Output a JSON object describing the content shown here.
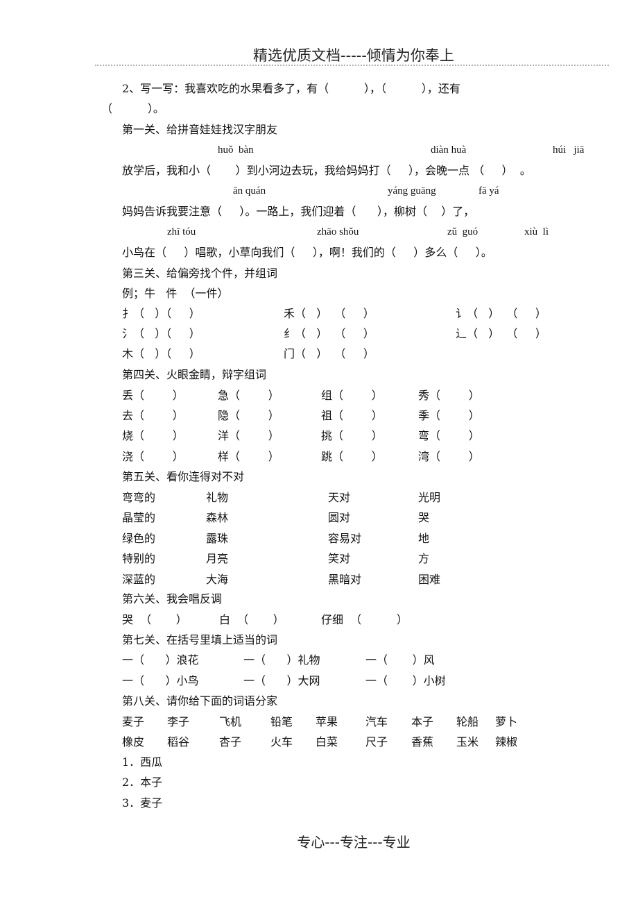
{
  "header": {
    "title": "精选优质文档-----倾情为你奉上"
  },
  "footer": {
    "text": "专心---专注---专业"
  },
  "section2": {
    "line1": "2、写一写：我喜欢吃的水果看多了，有（          ），（          ），还有",
    "line2": "（          ）。"
  },
  "section_1": {
    "title": "第一关、给拼音娃娃找汉字朋友",
    "pinyin_rows": [
      [
        "huǒ  bàn",
        "diàn huà",
        "húi   jiā"
      ],
      [
        "ān quán",
        "yáng guāng",
        "fā yá"
      ],
      [
        "zhī tóu",
        "zhāo shǒu",
        "zǔ  guó",
        "xiù  lì"
      ]
    ],
    "sentences": [
      "放学后，我和小（       ）到小河边去玩，我给妈妈打（     ），会晚一点 （     ）  。",
      "妈妈告诉我要注意（     ）。一路上，我们迎着（      ），柳树（    ）了，",
      "小鸟在（     ）唱歌，小草向我们（     ），啊！我们的（     ）多么（     ）。"
    ]
  },
  "section_3": {
    "title": "第三关、给偏旁找个件，并组词",
    "example": "例；牛   件  （一件）",
    "rows": [
      [
        "扌（   ）（     ）",
        "禾（   ）  （     ）",
        "讠（   ）  （     ）"
      ],
      [
        "氵（   ）（     ）",
        "纟（   ）  （     ）",
        "辶（   ）  （     ）"
      ],
      [
        "木（   ）（     ）",
        "门（   ）  （     ）",
        ""
      ]
    ]
  },
  "section_4": {
    "title": "第四关、火眼金睛，辩字组词",
    "rows": [
      [
        "丢（        ）",
        "急（        ）",
        "组（        ）",
        "秀（        ）"
      ],
      [
        "去（        ）",
        "隐（        ）",
        "祖（        ）",
        "季（        ）"
      ],
      [
        "烧（        ）",
        "洋（        ）",
        "挑（        ）",
        "弯（        ）"
      ],
      [
        "浇（        ）",
        "样（        ）",
        "跳（        ）",
        "湾（        ）"
      ]
    ]
  },
  "section_5": {
    "title": "第五关、看你连得对不对",
    "rows": [
      [
        "弯弯的",
        "礼物",
        "天对",
        "光明"
      ],
      [
        "晶莹的",
        "森林",
        "圆对",
        "哭"
      ],
      [
        "绿色的",
        "露珠",
        "容易对",
        "地"
      ],
      [
        "特别的",
        "月亮",
        "笑对",
        "方"
      ],
      [
        "深蓝的",
        "大海",
        "黑暗对",
        "困难"
      ]
    ]
  },
  "section_6": {
    "title": "第六关、我会唱反调",
    "items": [
      "哭  （       ）",
      "白  （       ）",
      "仔细  （          ）"
    ]
  },
  "section_7": {
    "title": "第七关、在括号里填上适当的词",
    "rows": [
      [
        "一（      ）浪花",
        "一（      ）礼物",
        "一（       ）风"
      ],
      [
        "一（      ）小鸟",
        "一（      ）大网",
        "一（       ）小树"
      ]
    ]
  },
  "section_8": {
    "title": "第八关、请你给下面的词语分家",
    "words_rows": [
      [
        "麦子",
        "李子",
        "飞机",
        "铅笔",
        "苹果",
        "汽车",
        "本子",
        "轮船",
        "萝卜"
      ],
      [
        "橡皮",
        "稻谷",
        "杏子",
        "火车",
        "白菜",
        "尺子",
        "香蕉",
        "玉米",
        "辣椒"
      ]
    ],
    "categories": [
      "1．西瓜",
      "2．本子",
      "3．麦子"
    ]
  }
}
